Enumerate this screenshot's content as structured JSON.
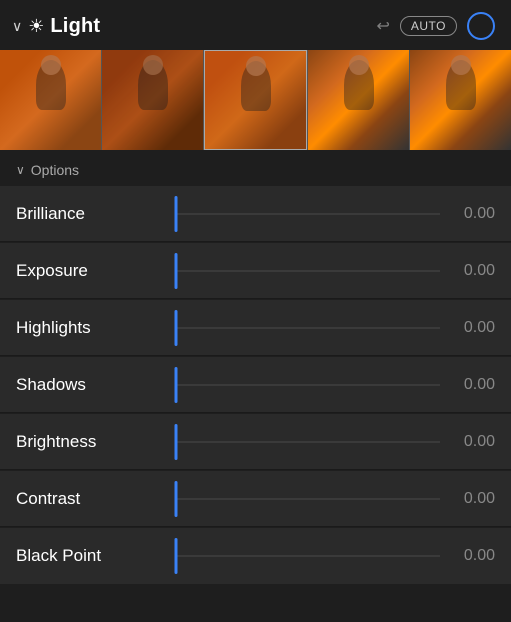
{
  "header": {
    "title": "Light",
    "undo_label": "↩",
    "auto_label": "AUTO",
    "chevron": "∨",
    "sun_icon": "☀"
  },
  "options": {
    "label": "Options",
    "chevron": "∨"
  },
  "sliders": [
    {
      "label": "Brilliance",
      "value": "0.00"
    },
    {
      "label": "Exposure",
      "value": "0.00"
    },
    {
      "label": "Highlights",
      "value": "0.00"
    },
    {
      "label": "Shadows",
      "value": "0.00"
    },
    {
      "label": "Brightness",
      "value": "0.00"
    },
    {
      "label": "Contrast",
      "value": "0.00"
    },
    {
      "label": "Black Point",
      "value": "0.00"
    }
  ],
  "colors": {
    "accent": "#3a82f7",
    "background": "#1e1e1e",
    "row_bg": "#2a2a2a",
    "text_primary": "#ffffff",
    "text_secondary": "#888888"
  }
}
